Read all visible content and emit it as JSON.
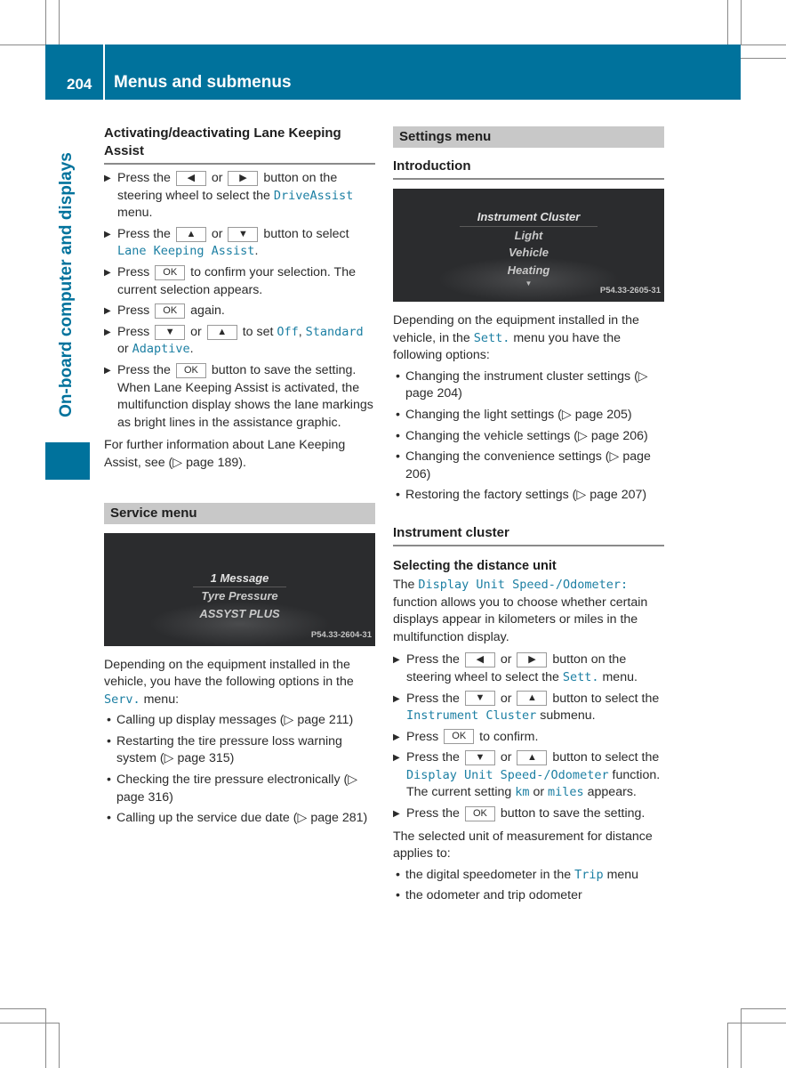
{
  "header": {
    "page_number": "204",
    "title": "Menus and submenus"
  },
  "sidebar": {
    "chapter": "On-board computer and displays"
  },
  "left": {
    "lka": {
      "heading": "Activating/deactivating Lane Keeping Assist",
      "steps": [
        {
          "a": "Press the",
          "k1": "◀",
          "or": "or",
          "k2": "▶",
          "b": "button on the steering wheel to select the",
          "m": "DriveAssist",
          "c": "menu."
        },
        {
          "a": "Press the",
          "k1": "▲",
          "or": "or",
          "k2": "▼",
          "b": "button to select",
          "m": "Lane Keeping Assist",
          "c": "."
        },
        {
          "a": "Press",
          "k1": "OK",
          "b": "to confirm your selection. The current selection appears."
        },
        {
          "a": "Press",
          "k1": "OK",
          "b": "again."
        },
        {
          "a": "Press",
          "k1": "▼",
          "or": "or",
          "k2": "▲",
          "b": "to set",
          "m1": "Off",
          "sep1": ",",
          "m2": "Standard",
          "or2": "or",
          "m3": "Adaptive",
          "c": "."
        },
        {
          "a": "Press the",
          "k1": "OK",
          "b": "button to save the setting. When Lane Keeping Assist is activated, the multifunction display shows the lane markings as bright lines in the assistance graphic."
        }
      ],
      "note": "For further information about Lane Keeping Assist, see (▷ page 189)."
    },
    "service": {
      "heading": "Service menu",
      "screen": {
        "items": [
          "1 Message",
          "Tyre Pressure",
          "ASSYST PLUS"
        ],
        "code": "P54.33-2604-31"
      },
      "intro_a": "Depending on the equipment installed in the vehicle, you have the following options in the",
      "intro_m": "Serv.",
      "intro_b": "menu:",
      "bullets": [
        "Calling up display messages (▷ page 211)",
        "Restarting the tire pressure loss warning system (▷ page 315)",
        "Checking the tire pressure electronically (▷ page 316)",
        "Calling up the service due date (▷ page 281)"
      ]
    }
  },
  "right": {
    "settings": {
      "heading": "Settings menu",
      "intro_heading": "Introduction",
      "screen": {
        "items": [
          "Instrument Cluster",
          "Light",
          "Vehicle",
          "Heating"
        ],
        "code": "P54.33-2605-31"
      },
      "intro_a": "Depending on the equipment installed in the vehicle, in the",
      "intro_m": "Sett.",
      "intro_b": "menu you have the following options:",
      "bullets": [
        "Changing the instrument cluster settings (▷ page 204)",
        "Changing the light settings (▷ page 205)",
        "Changing the vehicle settings (▷ page 206)",
        "Changing the convenience settings (▷ page 206)",
        "Restoring the factory settings (▷ page 207)"
      ]
    },
    "cluster": {
      "heading": "Instrument cluster",
      "sub": "Selecting the distance unit",
      "intro_a": "The",
      "intro_m": "Display Unit Speed-/Odometer:",
      "intro_b": "function allows you to choose whether certain displays appear in kilometers or miles in the multifunction display.",
      "steps": [
        {
          "a": "Press the",
          "k1": "◀",
          "or": "or",
          "k2": "▶",
          "b": "button on the steering wheel to select the",
          "m": "Sett.",
          "c": "menu."
        },
        {
          "a": "Press the",
          "k1": "▼",
          "or": "or",
          "k2": "▲",
          "b": "button to select the",
          "m": "Instrument Cluster",
          "c": "submenu."
        },
        {
          "a": "Press",
          "k1": "OK",
          "b": "to confirm."
        },
        {
          "a": "Press the",
          "k1": "▼",
          "or": "or",
          "k2": "▲",
          "b": "button to select the",
          "m": "Display Unit Speed-/Odometer",
          "c": "function.",
          "d": "The current setting",
          "m2": "km",
          "or2": "or",
          "m3": "miles",
          "e": "appears."
        },
        {
          "a": "Press the",
          "k1": "OK",
          "b": "button to save the setting."
        }
      ],
      "applies": "The selected unit of measurement for distance applies to:",
      "b1_a": "the digital speedometer in the",
      "b1_m": "Trip",
      "b1_b": "menu",
      "b2": "the odometer and trip odometer"
    }
  }
}
